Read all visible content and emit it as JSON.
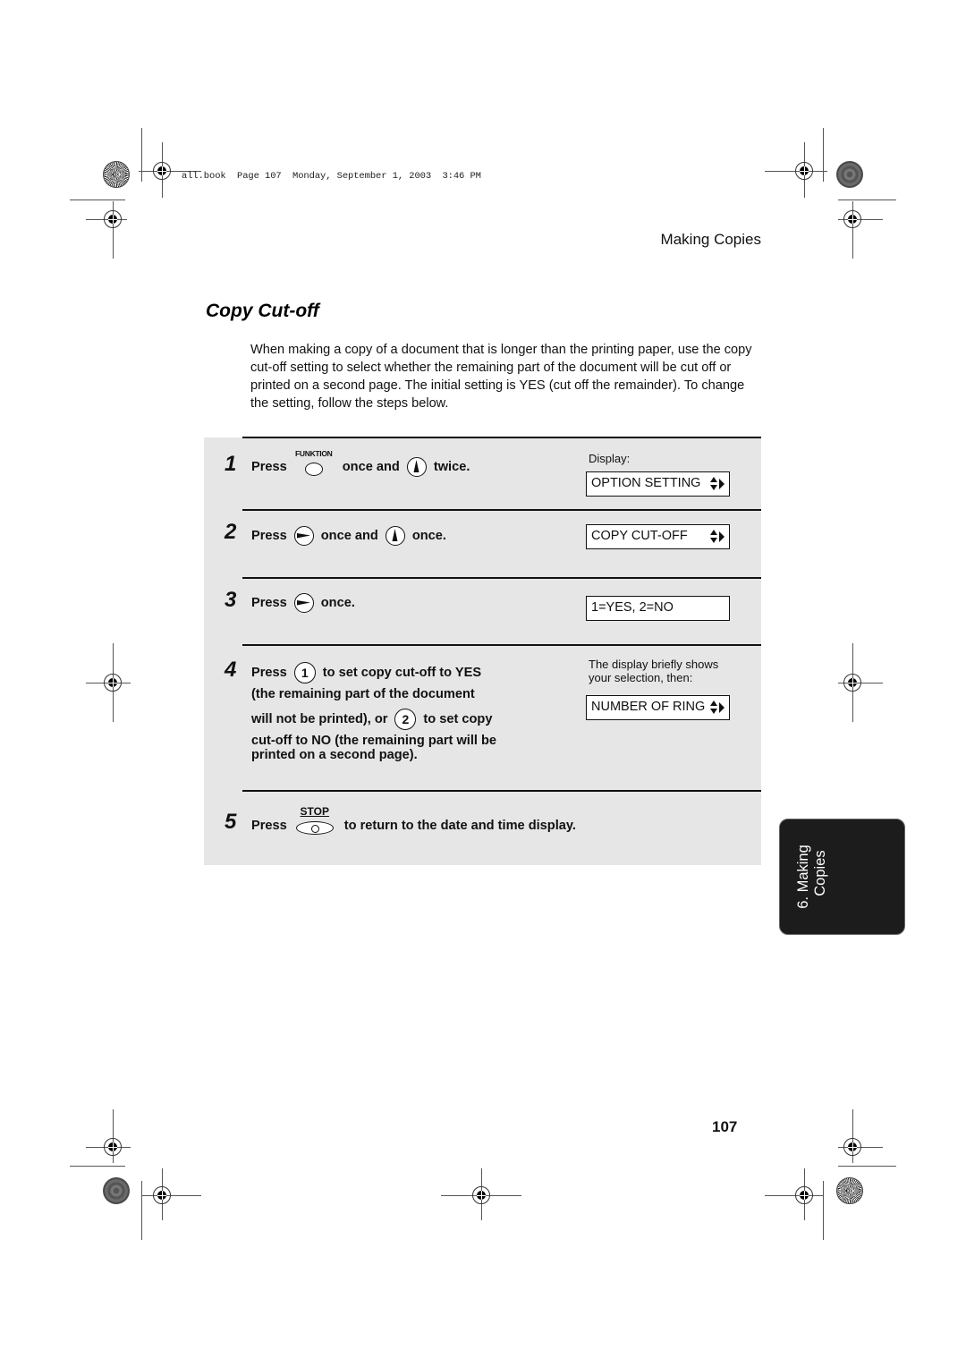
{
  "print_header": "all.book  Page 107  Monday, September 1, 2003  3:46 PM",
  "running_head": "Making Copies",
  "section_title": "Copy Cut-off",
  "intro_paragraph": "When making a copy of a document that is longer than the printing paper, use the copy cut-off setting to select whether the remaining part of the document will be cut off or printed on a second page. The initial setting is YES (cut off the remainder). To change the setting, follow the steps below.",
  "display_caption": "Display:",
  "steps": [
    {
      "number": "1",
      "press": "Press",
      "key1": {
        "name": "funktion-key",
        "label": "FUNKTION"
      },
      "mid": "once and",
      "key2": {
        "name": "up-arrow-key"
      },
      "end": "twice.",
      "display": "OPTION SETTING",
      "display_arrows": true
    },
    {
      "number": "2",
      "press": "Press",
      "key1": {
        "name": "right-arrow-key"
      },
      "mid": "once and",
      "key2": {
        "name": "up-arrow-key"
      },
      "end": "once.",
      "display": "COPY CUT-OFF",
      "display_arrows": true
    },
    {
      "number": "3",
      "press": "Press",
      "key1": {
        "name": "right-arrow-key"
      },
      "end": "once.",
      "display": "1=YES, 2=NO",
      "display_arrows": false
    },
    {
      "number": "4",
      "press": "Press",
      "key1": {
        "name": "number-key",
        "label": "1"
      },
      "line1_end": "to set copy cut-off to YES",
      "line2": "(the remaining part of the document",
      "line3_start": "will not be printed), or",
      "key2": {
        "name": "number-key",
        "label": "2"
      },
      "line3_end": "to set copy",
      "line4": "cut-off to NO (the remaining part will be",
      "line5": "printed on a second page).",
      "display_note": "The display briefly shows your selection, then:",
      "display": "NUMBER OF RING",
      "display_arrows": true
    },
    {
      "number": "5",
      "press": "Press",
      "key1": {
        "name": "stop-key",
        "label": "STOP"
      },
      "end": "to return to the date and time display."
    }
  ],
  "chapter_tab": {
    "line1": "6. Making",
    "line2": "Copies"
  },
  "page_number": "107"
}
